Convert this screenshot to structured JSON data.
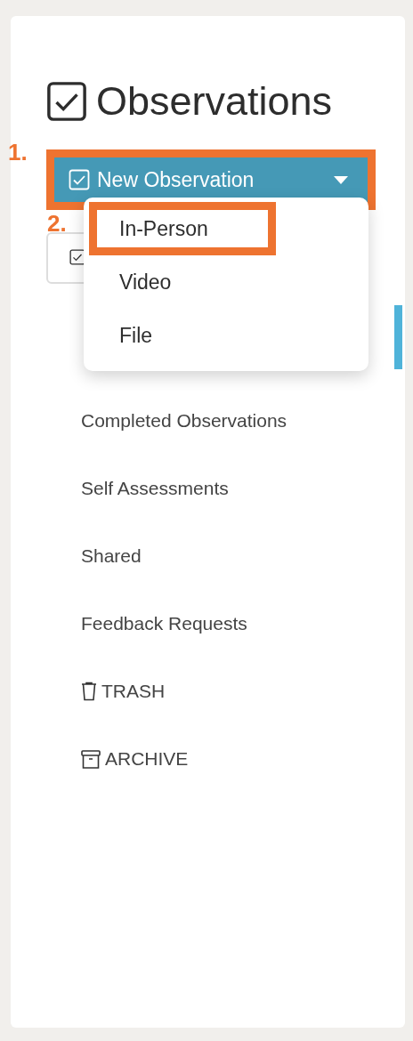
{
  "title": "Observations",
  "new_button": {
    "label": "New Observation",
    "highlighted": true,
    "annotation": "1."
  },
  "secondary_button": {
    "annotation": "2."
  },
  "menu": {
    "items": [
      {
        "label": "In-Person",
        "highlighted": true
      },
      {
        "label": "Video",
        "highlighted": false
      },
      {
        "label": "File",
        "highlighted": false
      }
    ]
  },
  "nav": {
    "items": [
      {
        "label": "Completed Observations",
        "kind": "link"
      },
      {
        "label": "Self Assessments",
        "kind": "link"
      },
      {
        "label": "Shared",
        "kind": "link"
      },
      {
        "label": "Feedback Requests",
        "kind": "link"
      },
      {
        "label": "TRASH",
        "kind": "trash"
      },
      {
        "label": "ARCHIVE",
        "kind": "archive"
      }
    ]
  }
}
